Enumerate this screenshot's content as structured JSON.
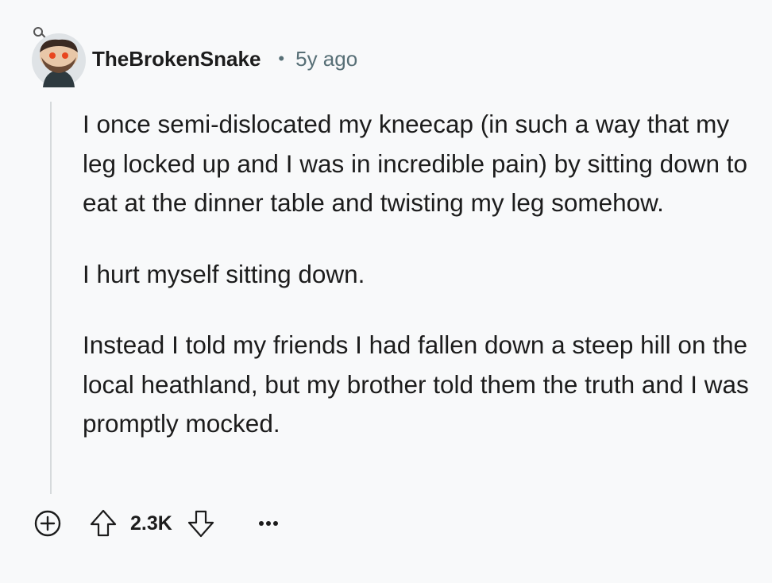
{
  "comment": {
    "author": "TheBrokenSnake",
    "separator": "•",
    "age": "5y ago",
    "paragraphs": [
      "I once semi-dislocated my kneecap (in such a way that my leg locked up and I was in incredible pain) by sitting down to eat at the dinner table and twisting my leg somehow.",
      "I hurt myself sitting down.",
      "Instead I told my friends I had fallen down a steep hill on the local heathland, but my brother told them the truth and I was promptly mocked."
    ],
    "score": "2.3K"
  },
  "icons": {
    "avatar": "snoo-avatar-icon",
    "expand": "plus-circle-icon",
    "upvote": "upvote-arrow-icon",
    "downvote": "downvote-arrow-icon",
    "more": "ellipsis-icon"
  },
  "colors": {
    "background": "#f8f9fa",
    "text": "#1c1c1c",
    "muted": "#576f76",
    "thread_line": "#d6dadc"
  }
}
